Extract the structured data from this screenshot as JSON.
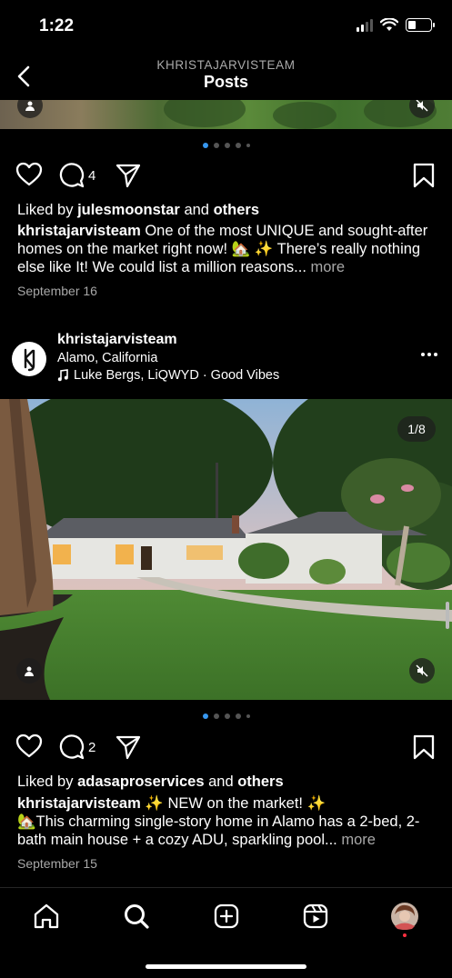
{
  "status": {
    "time": "1:22"
  },
  "header": {
    "account": "KHRISTAJARVISTEAM",
    "title": "Posts"
  },
  "post1": {
    "comment_count": "4",
    "liked_by_prefix": "Liked by",
    "liked_by_user": "julesmoonstar",
    "liked_by_join": "and",
    "liked_by_others": "others",
    "author": "khristajarvisteam",
    "caption": "One of the most UNIQUE and sought-after homes on the market right now! 🏡 ✨ There’s really nothing else like It! We could list a million reasons...",
    "more": "more",
    "date": "September 16"
  },
  "post2": {
    "username": "khristajarvisteam",
    "location": "Alamo, California",
    "music": "Luke Bergs, LiQWYD · Good Vibes",
    "photo_counter": "1/8",
    "comment_count": "2",
    "liked_by_prefix": "Liked by",
    "liked_by_user": "adasaproservices",
    "liked_by_join": "and",
    "liked_by_others": "others",
    "author": "khristajarvisteam",
    "caption_line1": "✨ NEW on the market! ✨",
    "caption_line2": "🏡This charming single-story home in Alamo has a 2-bed, 2-bath main house + a cozy ADU, sparkling pool...",
    "more": "more",
    "date": "September 15"
  },
  "icons": {
    "back": "chevron-left-icon",
    "like": "heart-icon",
    "comment": "comment-icon",
    "share": "send-icon",
    "save": "bookmark-icon",
    "home": "home-icon",
    "search": "search-icon",
    "create": "plus-square-icon",
    "reels": "reels-icon"
  },
  "colors": {
    "background": "#000000",
    "accent_dot": "#3797f0",
    "muted_text": "#a8a8a8",
    "notification_dot": "#ff3040"
  }
}
